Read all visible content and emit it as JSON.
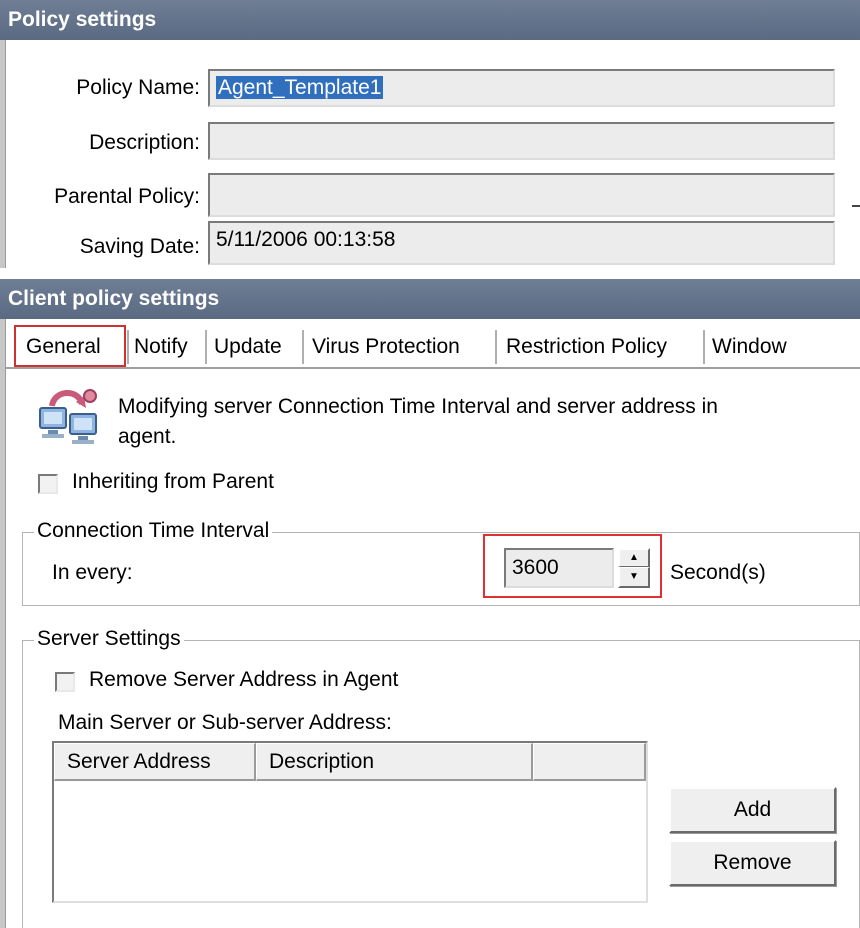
{
  "policy_settings": {
    "header": "Policy settings",
    "policy_name_label": "Policy Name:",
    "policy_name_value": "Agent_Template1",
    "description_label": "Description:",
    "description_value": "",
    "parental_policy_label": "Parental Policy:",
    "parental_policy_value": "",
    "saving_date_label": "Saving Date:",
    "saving_date_value": "5/11/2006 00:13:58"
  },
  "client_policy": {
    "header": "Client policy settings",
    "tabs": [
      {
        "label": "General",
        "selected": true
      },
      {
        "label": "Notify"
      },
      {
        "label": "Update"
      },
      {
        "label": "Virus Protection"
      },
      {
        "label": "Restriction Policy"
      },
      {
        "label": "Window"
      }
    ]
  },
  "general": {
    "info_line1": "Modifying server Connection Time Interval and server address in",
    "info_line2": "agent.",
    "inherit_label": "Inheriting from Parent",
    "inherit_checked": false,
    "connection": {
      "title": "Connection Time Interval",
      "in_every_label": "In every:",
      "interval_value": "3600",
      "unit_label": "Second(s)"
    },
    "server": {
      "title": "Server Settings",
      "remove_label": "Remove Server Address in Agent",
      "remove_checked": false,
      "address_label": "Main Server or Sub-server Address:",
      "columns": [
        "Server Address",
        "Description",
        ""
      ],
      "rows": [],
      "add_label": "Add",
      "remove_button_label": "Remove"
    }
  },
  "colors": {
    "header_bar": "#5f6f88",
    "selection": "#2f6fbe",
    "highlight_box": "#e03030"
  }
}
